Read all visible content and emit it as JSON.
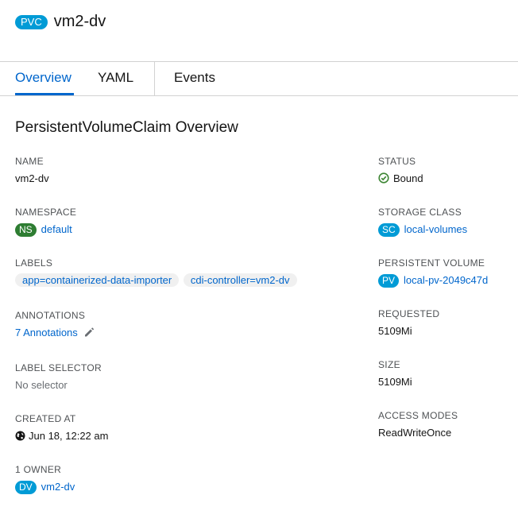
{
  "header": {
    "kind_badge": "PVC",
    "title": "vm2-dv"
  },
  "tabs": [
    {
      "label": "Overview",
      "active": true
    },
    {
      "label": "YAML",
      "active": false
    },
    {
      "label": "Events",
      "active": false
    }
  ],
  "section_title": "PersistentVolumeClaim Overview",
  "colors": {
    "accent": "#0066cc",
    "pvc_badge": "#009bd6",
    "ns_badge": "#2e7d32",
    "sc_badge": "#009bd6",
    "pv_badge": "#009bd6",
    "dv_badge": "#009bd6",
    "bound_status": "#3e8635"
  },
  "left": {
    "name": {
      "label": "NAME",
      "value": "vm2-dv"
    },
    "namespace": {
      "label": "NAMESPACE",
      "badge": "NS",
      "value": "default"
    },
    "labels": {
      "label": "LABELS",
      "items": [
        "app=containerized-data-importer",
        "cdi-controller=vm2-dv"
      ]
    },
    "annotations": {
      "label": "ANNOTATIONS",
      "value": "7 Annotations",
      "icon": "pencil-icon"
    },
    "label_selector": {
      "label": "LABEL SELECTOR",
      "value": "No selector"
    },
    "created_at": {
      "label": "CREATED AT",
      "value": "Jun 18, 12:22 am",
      "icon": "globe-icon"
    },
    "owner": {
      "label": "1 OWNER",
      "badge": "DV",
      "value": "vm2-dv"
    }
  },
  "right": {
    "status": {
      "label": "STATUS",
      "value": "Bound",
      "icon": "check-circle-icon"
    },
    "storage_class": {
      "label": "STORAGE CLASS",
      "badge": "SC",
      "value": "local-volumes"
    },
    "persistent_volume": {
      "label": "PERSISTENT VOLUME",
      "badge": "PV",
      "value": "local-pv-2049c47d"
    },
    "requested": {
      "label": "REQUESTED",
      "value": "5109Mi"
    },
    "size": {
      "label": "SIZE",
      "value": "5109Mi"
    },
    "access_modes": {
      "label": "ACCESS MODES",
      "value": "ReadWriteOnce"
    }
  }
}
